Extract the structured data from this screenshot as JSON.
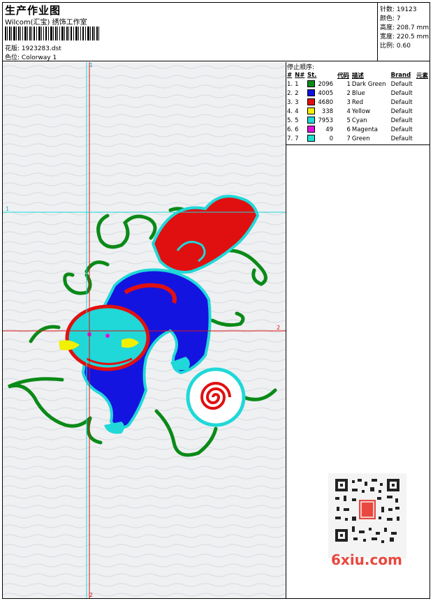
{
  "header": {
    "title": "生产作业图",
    "company": "Wilcom(汇宝) 绣饰工作室",
    "pattern_label": "花版:",
    "pattern_value": "1923283.dst",
    "colorway_label": "色位:",
    "colorway_value": "Colorway 1"
  },
  "stats": {
    "stitches_label": "针数:",
    "stitches_value": "19123",
    "colors_label": "颜色:",
    "colors_value": "7",
    "height_label": "高度:",
    "height_value": "208.7 mm",
    "width_label": "宽度:",
    "width_value": "220.5 mm",
    "scale_label": "比例:",
    "scale_value": "0.60"
  },
  "canvas": {
    "marker_top": "1",
    "marker_left": "1",
    "marker_right": "2",
    "marker_bottom": "2"
  },
  "stop_sequence": {
    "title": "停止顺序:",
    "headers": [
      "#",
      "N#",
      "St.",
      "代码",
      "描述",
      "Brand",
      "元素"
    ],
    "rows": [
      {
        "idx": "1.",
        "n": "1",
        "color": "#0a8a18",
        "st": "2096",
        "code": "1",
        "desc": "Dark Green",
        "brand": "Default",
        "elem": ""
      },
      {
        "idx": "2.",
        "n": "2",
        "color": "#1010e0",
        "st": "4005",
        "code": "2",
        "desc": "Blue",
        "brand": "Default",
        "elem": ""
      },
      {
        "idx": "3.",
        "n": "3",
        "color": "#e01010",
        "st": "4680",
        "code": "3",
        "desc": "Red",
        "brand": "Default",
        "elem": ""
      },
      {
        "idx": "4.",
        "n": "4",
        "color": "#f0f000",
        "st": "338",
        "code": "4",
        "desc": "Yellow",
        "brand": "Default",
        "elem": ""
      },
      {
        "idx": "5.",
        "n": "5",
        "color": "#20d8d8",
        "st": "7953",
        "code": "5",
        "desc": "Cyan",
        "brand": "Default",
        "elem": ""
      },
      {
        "idx": "6.",
        "n": "6",
        "color": "#e010e0",
        "st": "49",
        "code": "6",
        "desc": "Magenta",
        "brand": "Default",
        "elem": ""
      },
      {
        "idx": "7.",
        "n": "7",
        "color": "#20e0d0",
        "st": "0",
        "code": "7",
        "desc": "Green",
        "brand": "Default",
        "elem": ""
      }
    ]
  },
  "watermark": {
    "text": "6xiu.com"
  }
}
